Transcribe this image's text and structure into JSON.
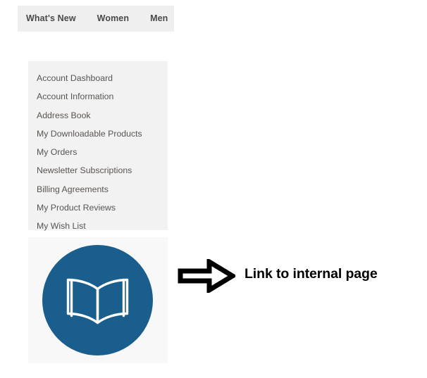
{
  "nav": {
    "items": [
      {
        "label": "What's New"
      },
      {
        "label": "Women"
      },
      {
        "label": "Men"
      }
    ]
  },
  "sidebar": {
    "items": [
      {
        "label": "Account Dashboard"
      },
      {
        "label": "Account Information"
      },
      {
        "label": "Address Book"
      },
      {
        "label": "My Downloadable Products"
      },
      {
        "label": "My Orders"
      },
      {
        "label": "Newsletter Subscriptions"
      },
      {
        "label": "Billing Agreements"
      },
      {
        "label": "My Product Reviews"
      },
      {
        "label": "My Wish List"
      }
    ]
  },
  "tile": {
    "icon_name": "open-book-icon",
    "circle_color": "#1A5E8E",
    "glyph_color": "#ffffff",
    "background": "#f8f8f8"
  },
  "callout": {
    "arrow_icon": "right-arrow-icon",
    "label": "Link to internal page",
    "arrow_fill": "#ffffff",
    "arrow_stroke": "#000000",
    "label_color": "#000000"
  },
  "colors": {
    "nav_background": "#efefef",
    "nav_text": "#494949",
    "sidebar_background": "#f2f2f2",
    "sidebar_text": "#585450",
    "page_background": "#ffffff"
  }
}
